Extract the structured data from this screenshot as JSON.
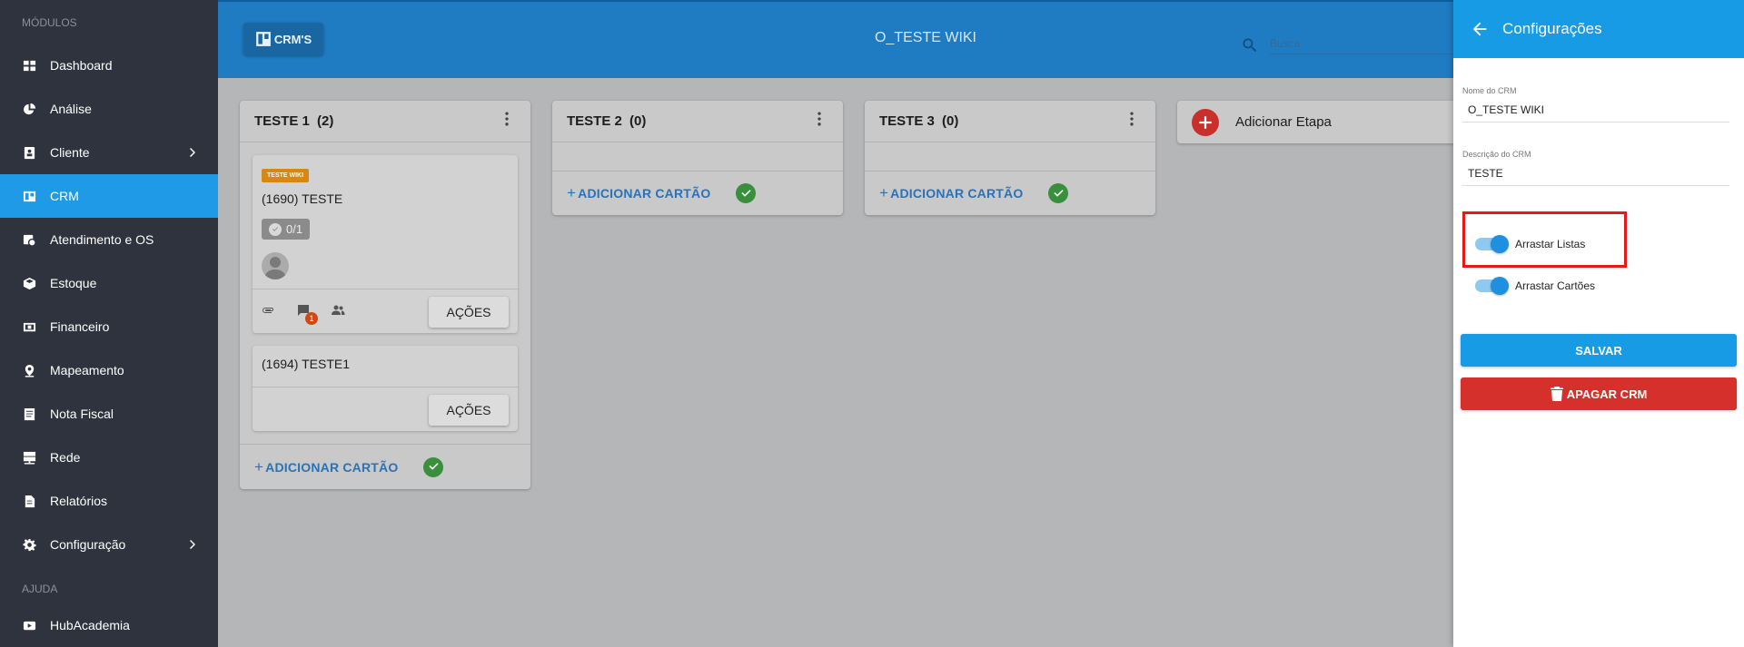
{
  "sidebar": {
    "section_modules": "MÓDULOS",
    "section_help": "AJUDA",
    "items": [
      {
        "label": "Dashboard",
        "icon": "grid-icon"
      },
      {
        "label": "Análise",
        "icon": "pie-chart-icon"
      },
      {
        "label": "Cliente",
        "icon": "contact-icon"
      },
      {
        "label": "CRM",
        "icon": "board-icon"
      },
      {
        "label": "Atendimento e OS",
        "icon": "calendar-clock-icon"
      },
      {
        "label": "Estoque",
        "icon": "box-icon"
      },
      {
        "label": "Financeiro",
        "icon": "money-icon"
      },
      {
        "label": "Mapeamento",
        "icon": "pin-icon"
      },
      {
        "label": "Nota Fiscal",
        "icon": "document-icon"
      },
      {
        "label": "Rede",
        "icon": "network-icon"
      },
      {
        "label": "Relatórios",
        "icon": "file-icon"
      },
      {
        "label": "Configuração",
        "icon": "gear-icon"
      }
    ],
    "help_items": [
      {
        "label": "HubAcademia",
        "icon": "play-icon"
      }
    ],
    "active_item": "CRM"
  },
  "topbar": {
    "crms_label": "CRM'S",
    "title": "O_TESTE WIKI",
    "search_placeholder": "Busca"
  },
  "board": {
    "columns": [
      {
        "title": "TESTE 1",
        "count": "(2)",
        "add_card": "ADICIONAR CARTÃO"
      },
      {
        "title": "TESTE 2",
        "count": "(0)",
        "add_card": "ADICIONAR CARTÃO"
      },
      {
        "title": "TESTE 3",
        "count": "(0)",
        "add_card": "ADICIONAR CARTÃO"
      }
    ],
    "cards": [
      {
        "tag": "TESTE WIKI",
        "title": "(1690) TESTE",
        "checklist": "0/1",
        "comments_badge": "1",
        "actions": "AÇÕES"
      },
      {
        "title": "(1694) TESTE1",
        "actions": "AÇÕES"
      }
    ],
    "add_stage": "Adicionar Etapa"
  },
  "panel": {
    "title": "Configurações",
    "name_label": "Nome do CRM",
    "name_value": "O_TESTE WIKI",
    "desc_label": "Descrição do CRM",
    "desc_value": "TESTE",
    "toggle_lists": "Arrastar Listas",
    "toggle_cards": "Arrastar Cartões",
    "toggle_lists_on": true,
    "toggle_cards_on": true,
    "save": "SALVAR",
    "delete": "APAGAR CRM"
  },
  "colors": {
    "sidebar_bg": "#2e333e",
    "accent": "#169be4",
    "topbar": "#1f7bc2",
    "danger": "#d5302c",
    "highlight": "#e61818"
  }
}
